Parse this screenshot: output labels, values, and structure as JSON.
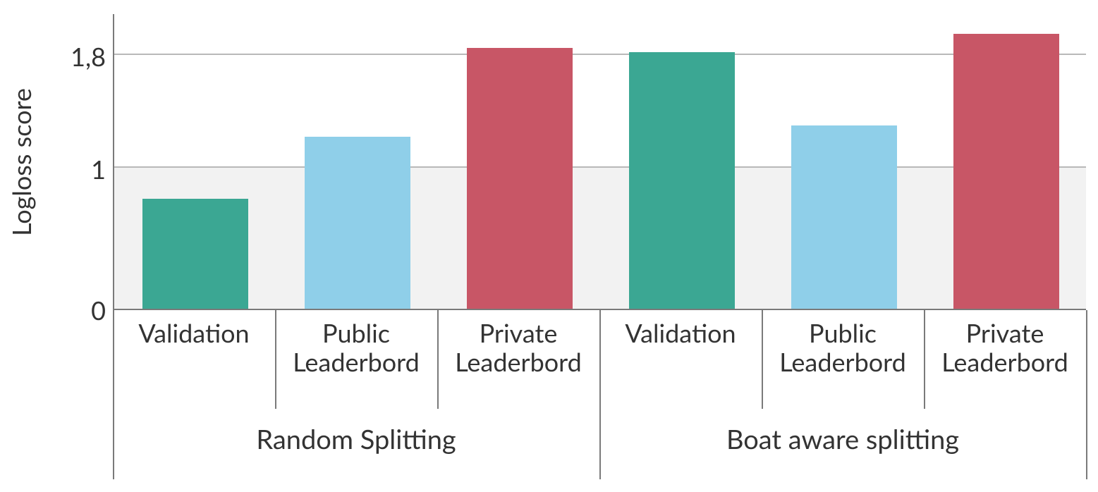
{
  "chart_data": {
    "type": "bar",
    "ylabel": "Logloss score",
    "xlabel": "",
    "ylim": [
      0,
      2.1
    ],
    "yticks": [
      0,
      1,
      1.8
    ],
    "ytick_labels": [
      "0",
      "1",
      "1,8"
    ],
    "groups": [
      {
        "name": "Random Splitting",
        "bars": [
          {
            "label_line1": "Validation",
            "label_line2": "",
            "value": 0.78,
            "color": "teal"
          },
          {
            "label_line1": "Public",
            "label_line2": "Leaderbord",
            "value": 1.22,
            "color": "sky"
          },
          {
            "label_line1": "Private",
            "label_line2": "Leaderbord",
            "value": 1.85,
            "color": "rose"
          }
        ]
      },
      {
        "name": "Boat aware splitting",
        "bars": [
          {
            "label_line1": "Validation",
            "label_line2": "",
            "value": 1.82,
            "color": "teal"
          },
          {
            "label_line1": "Public",
            "label_line2": "Leaderbord",
            "value": 1.3,
            "color": "sky"
          },
          {
            "label_line1": "Private",
            "label_line2": "Leaderbord",
            "value": 1.95,
            "color": "rose"
          }
        ]
      }
    ],
    "colors": {
      "teal": "#3ba793",
      "sky": "#8fcfe9",
      "rose": "#c85666"
    },
    "title": ""
  }
}
